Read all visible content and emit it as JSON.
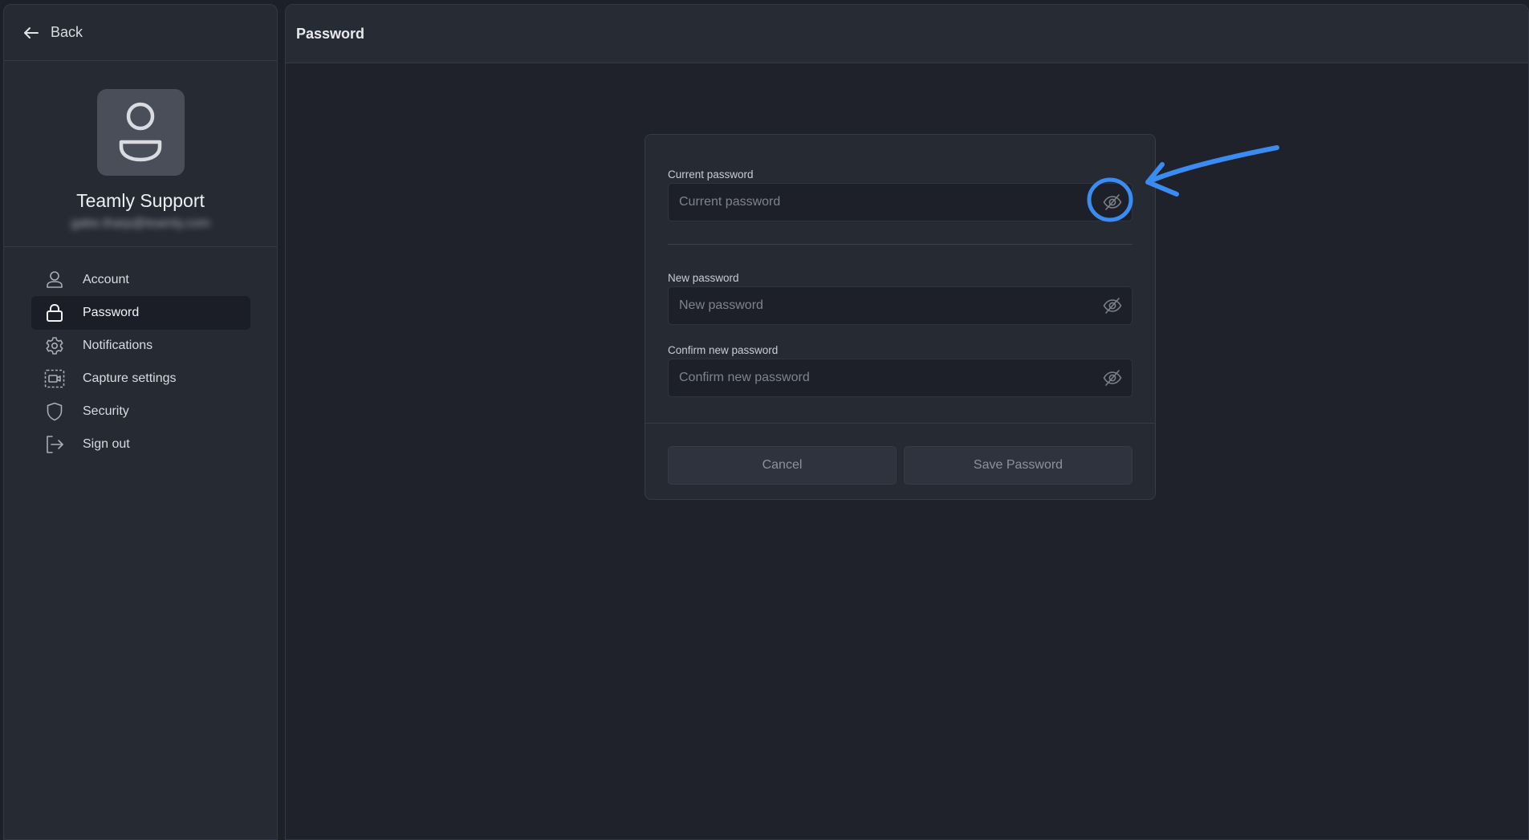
{
  "sidebar": {
    "back_label": "Back",
    "profile": {
      "name": "Teamly Support",
      "email": "gabe.tharp@teamly.com"
    },
    "items": [
      {
        "label": "Account",
        "icon": "user-icon",
        "active": false
      },
      {
        "label": "Password",
        "icon": "lock-icon",
        "active": true
      },
      {
        "label": "Notifications",
        "icon": "gear-icon",
        "active": false
      },
      {
        "label": "Capture settings",
        "icon": "video-capture-icon",
        "active": false
      },
      {
        "label": "Security",
        "icon": "shield-icon",
        "active": false
      },
      {
        "label": "Sign out",
        "icon": "sign-out-icon",
        "active": false
      }
    ]
  },
  "main": {
    "title": "Password",
    "form": {
      "current": {
        "label": "Current password",
        "placeholder": "Current password",
        "value": ""
      },
      "new": {
        "label": "New password",
        "placeholder": "New password",
        "value": ""
      },
      "confirm": {
        "label": "Confirm new password",
        "placeholder": "Confirm new password",
        "value": ""
      },
      "cancel_label": "Cancel",
      "save_label": "Save Password"
    }
  },
  "annotation": {
    "color": "#3b8cf2",
    "target": "current-password-visibility-toggle"
  },
  "colors": {
    "background": "#1d2029",
    "panel": "#262a33",
    "active_item": "#1b1e26",
    "accent_annotation": "#3b8cf2"
  }
}
